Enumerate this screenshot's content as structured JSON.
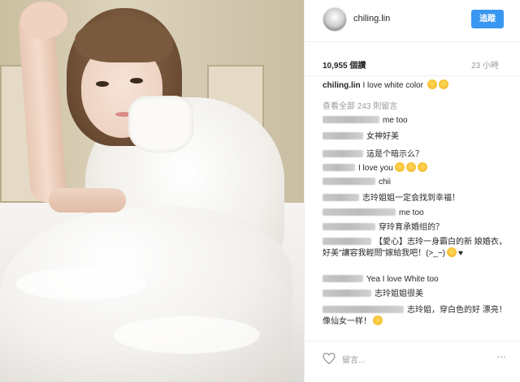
{
  "post": {
    "username": "chiling.lin",
    "follow_label": "追蹤",
    "likes": "10,955 個讚",
    "time": "23 小時",
    "caption_user": "chiling.lin",
    "caption_text": "I love white color",
    "view_all": "查看全部 243 則留言",
    "add_comment": "留言...",
    "more": "⋯"
  },
  "comments": [
    {
      "blur_w": 70,
      "text": "me too"
    },
    {
      "blur_w": 50,
      "text": "女神好美"
    },
    {
      "blur_w": 50,
      "text": "這是个暗示么？"
    },
    {
      "blur_w": 40,
      "text": "I love you",
      "emoji": 3
    },
    {
      "blur_w": 65,
      "text": "chii"
    },
    {
      "blur_w": 45,
      "text": "志玲姐姐一定会找到幸福！"
    },
    {
      "blur_w": 90,
      "text": "me too"
    },
    {
      "blur_w": 65,
      "text": "穿玲育承婚组的？"
    },
    {
      "blur_w": 60,
      "text": "【愛心】志玲一身霸白的新 娘婚衣，好美\"讓容我輕問\"嫁給我吧！(>_~)",
      "emoji": 1,
      "extra": "♥"
    },
    {
      "blur_w": 50,
      "text": "Yea I love White too"
    },
    {
      "blur_w": 60,
      "text": "志玲姐姐很美"
    },
    {
      "blur_w": 100,
      "text": "志玲姐，穿白色的好 漂亮！像仙女一样！",
      "emoji": 1
    }
  ]
}
